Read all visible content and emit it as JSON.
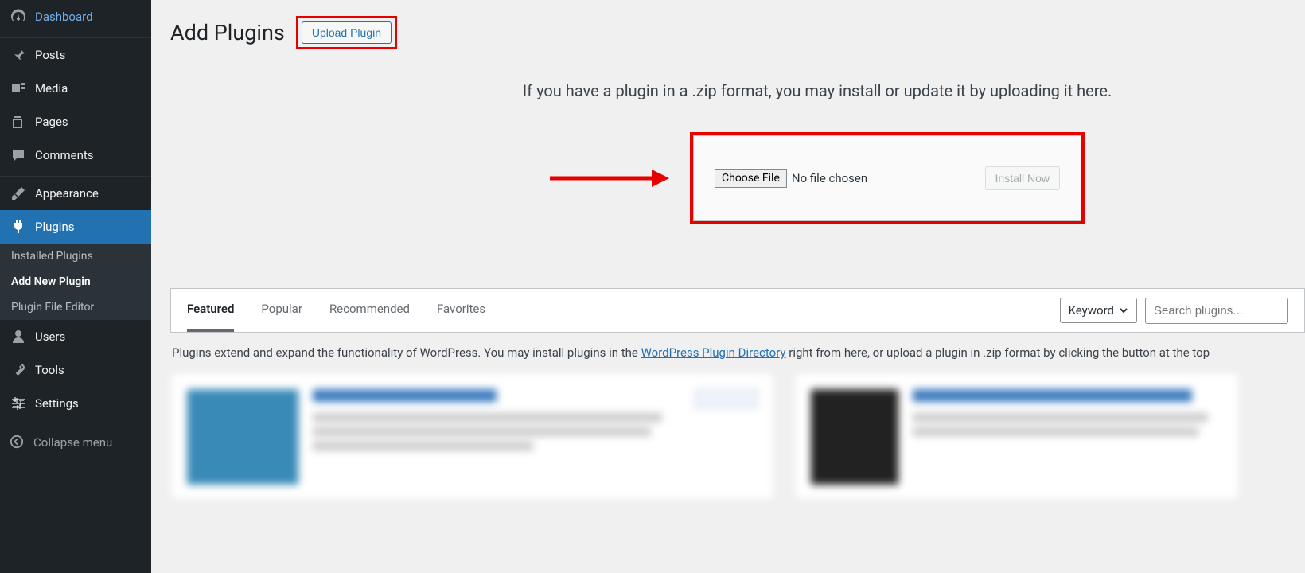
{
  "sidebar": {
    "items": [
      {
        "id": "dashboard",
        "label": "Dashboard",
        "icon": "gauge"
      },
      {
        "id": "posts",
        "label": "Posts",
        "icon": "pin"
      },
      {
        "id": "media",
        "label": "Media",
        "icon": "media"
      },
      {
        "id": "pages",
        "label": "Pages",
        "icon": "copy"
      },
      {
        "id": "comments",
        "label": "Comments",
        "icon": "chat"
      },
      {
        "id": "appearance",
        "label": "Appearance",
        "icon": "brush"
      },
      {
        "id": "plugins",
        "label": "Plugins",
        "icon": "plug",
        "active": true
      },
      {
        "id": "users",
        "label": "Users",
        "icon": "user"
      },
      {
        "id": "tools",
        "label": "Tools",
        "icon": "wrench"
      },
      {
        "id": "settings",
        "label": "Settings",
        "icon": "sliders"
      }
    ],
    "plugins_sub": [
      {
        "id": "installed",
        "label": "Installed Plugins"
      },
      {
        "id": "add-new",
        "label": "Add New Plugin",
        "current": true
      },
      {
        "id": "file-editor",
        "label": "Plugin File Editor"
      }
    ],
    "collapse_label": "Collapse menu"
  },
  "page": {
    "title": "Add Plugins",
    "upload_btn": "Upload Plugin",
    "upload_info": "If you have a plugin in a .zip format, you may install or update it by uploading it here.",
    "choose_btn": "Choose File",
    "no_file": "No file chosen",
    "install_btn": "Install Now"
  },
  "tabs": {
    "items": [
      {
        "id": "featured",
        "label": "Featured",
        "active": true
      },
      {
        "id": "popular",
        "label": "Popular"
      },
      {
        "id": "recommended",
        "label": "Recommended"
      },
      {
        "id": "favorites",
        "label": "Favorites"
      }
    ],
    "keyword_label": "Keyword",
    "search_placeholder": "Search plugins..."
  },
  "blurb": {
    "prefix": "Plugins extend and expand the functionality of WordPress. You may install plugins in the ",
    "link": "WordPress Plugin Directory",
    "suffix": " right from here, or upload a plugin in .zip format by clicking the button at the top"
  }
}
